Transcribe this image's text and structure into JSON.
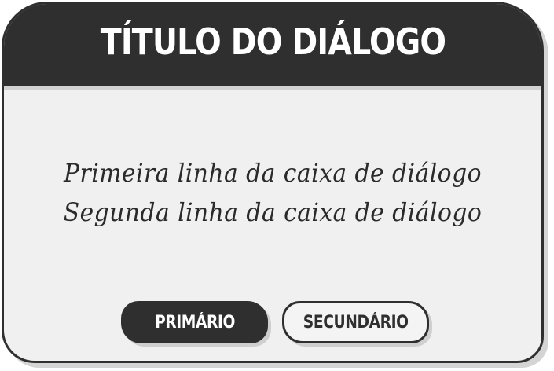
{
  "dialog": {
    "title": "TÍTULO DO DIÁLOGO",
    "lines": [
      "Primeira linha da caixa de diálogo",
      "Segunda linha da caixa de diálogo"
    ],
    "buttons": {
      "primary_label": "PRIMÁRIO",
      "secondary_label": "SECUNDÁRIO"
    }
  },
  "colors": {
    "titlebar": "#2f2f2f",
    "body_background": "#f0f0f0",
    "primary_button": "#2f2f2f",
    "secondary_button_border": "#2f2f2f"
  }
}
